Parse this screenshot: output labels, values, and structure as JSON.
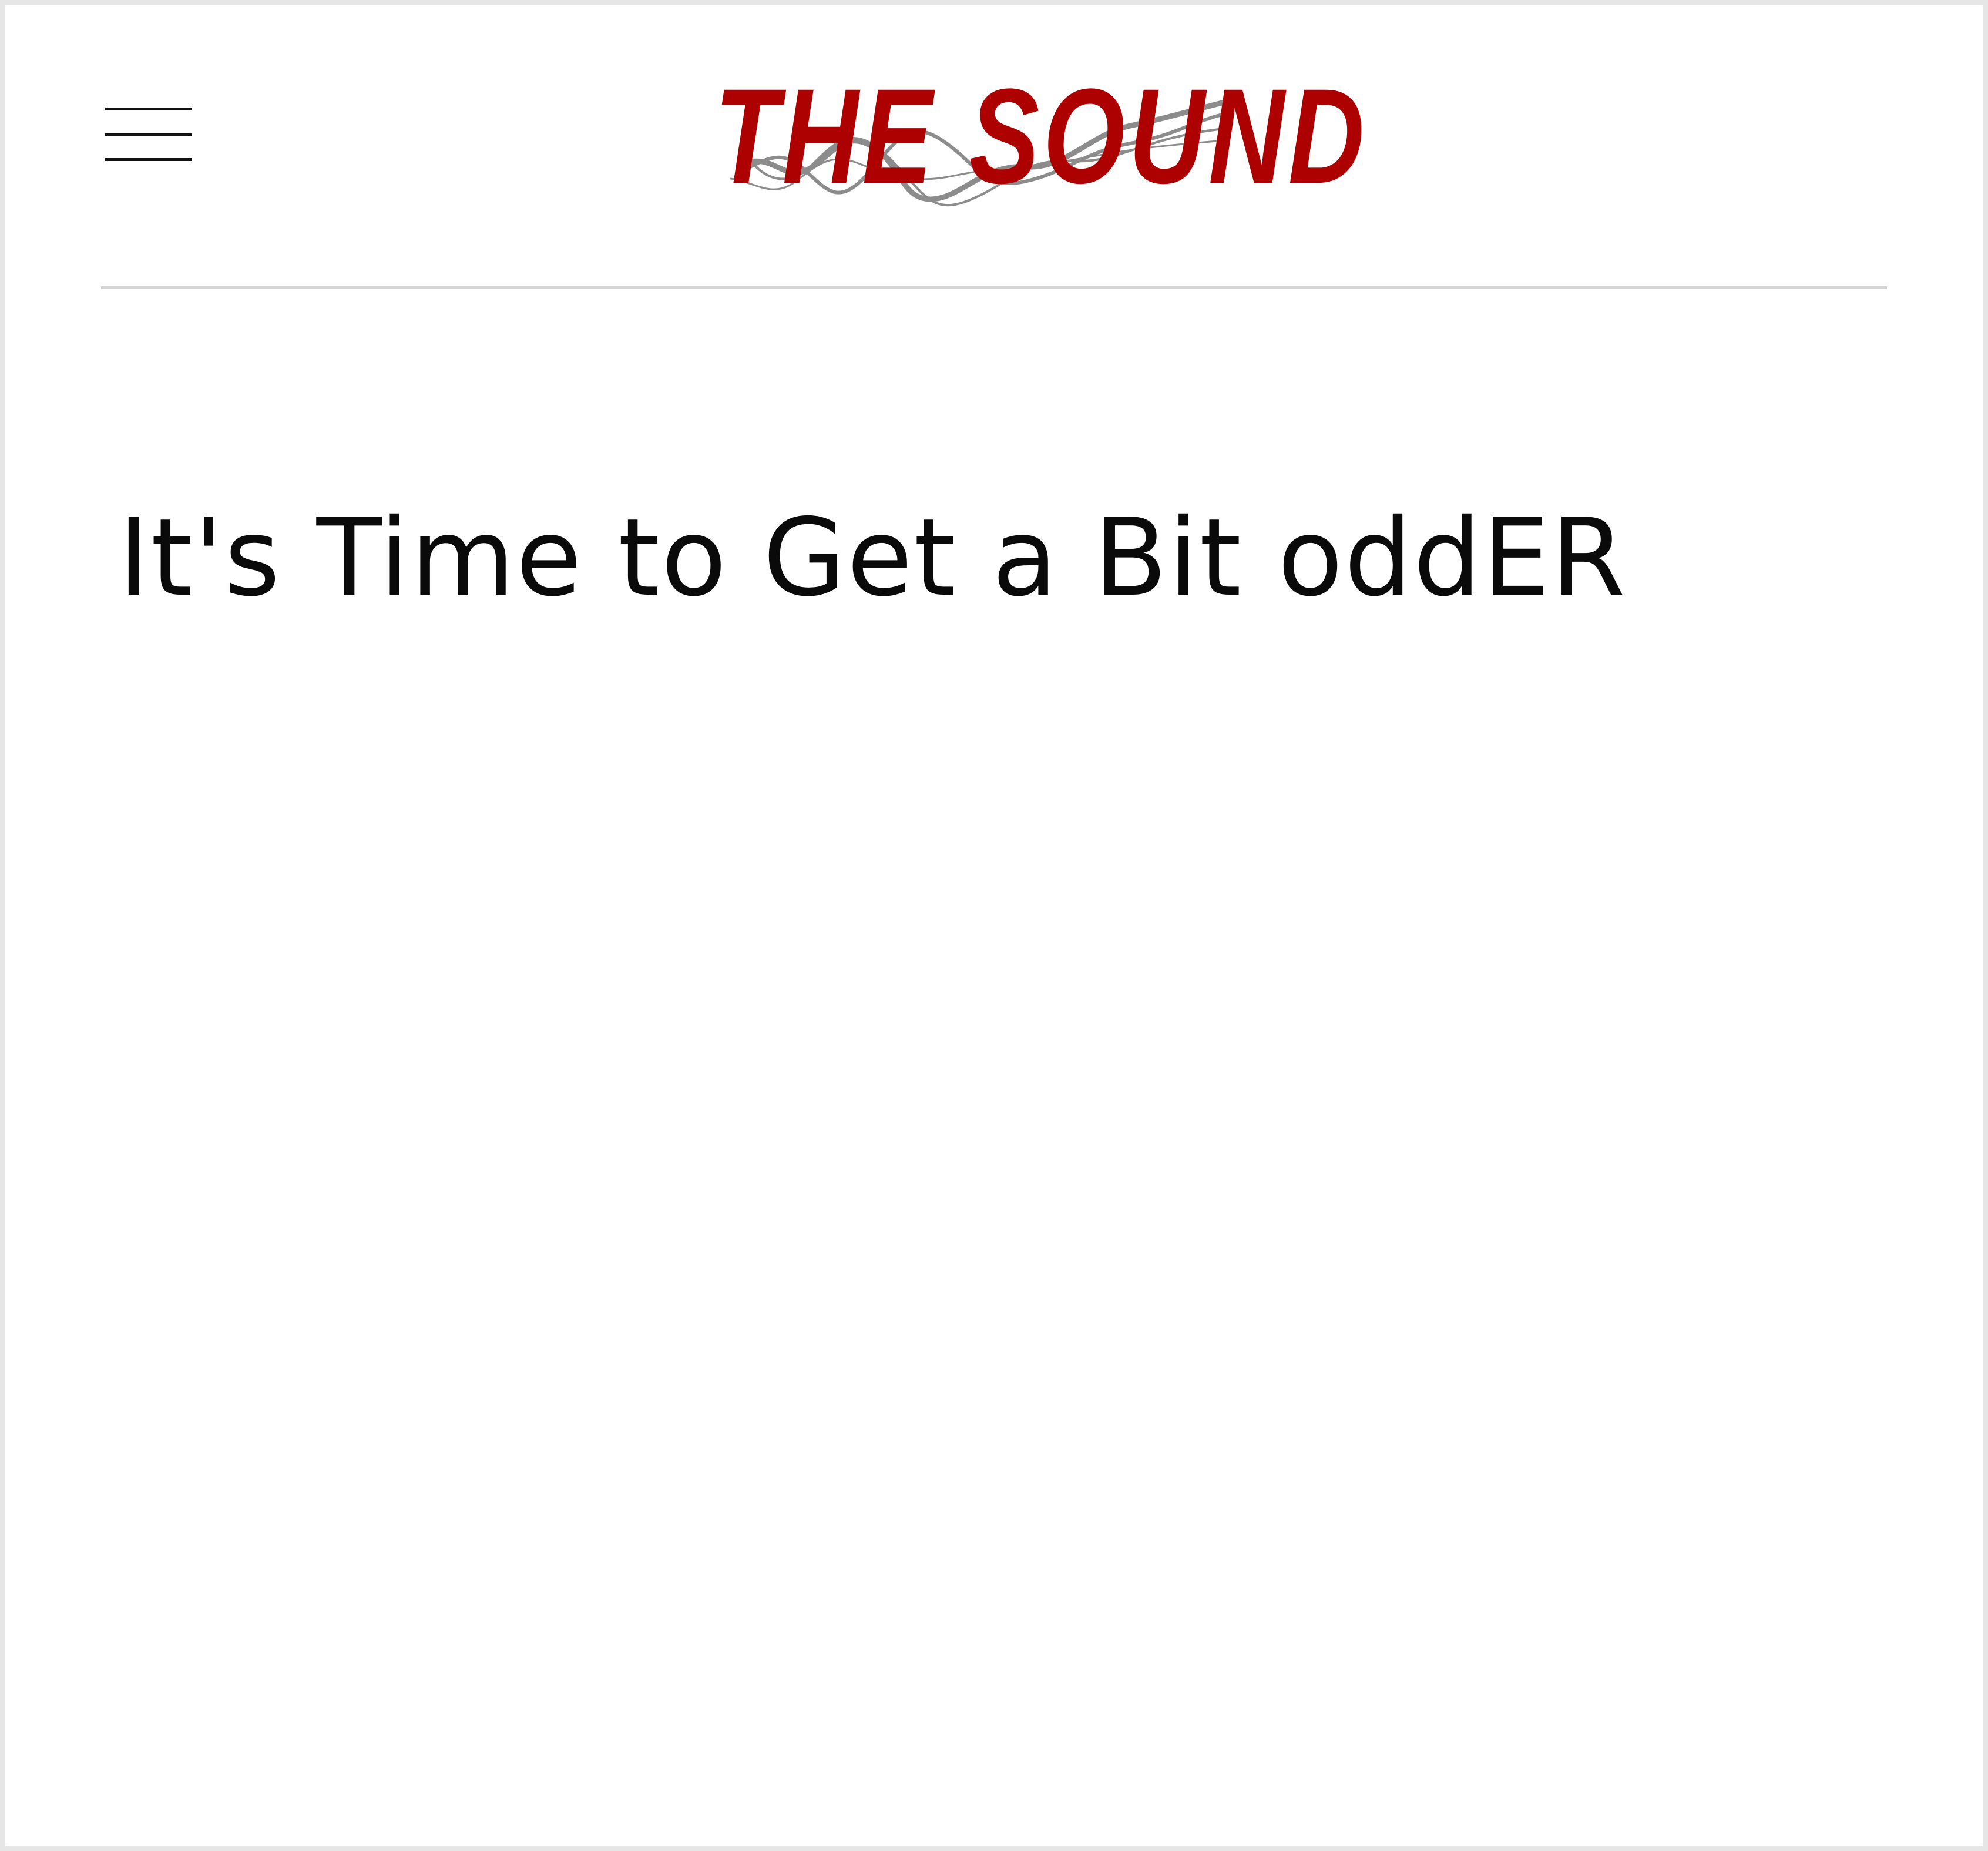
{
  "header": {
    "menu_icon": "hamburger-menu-icon",
    "logo_text": "THE SOUND",
    "logo_color": "#ad0000",
    "logo_wave_color": "#8c8c8c"
  },
  "article": {
    "title": "It's Time to Get a Bit oddER"
  }
}
